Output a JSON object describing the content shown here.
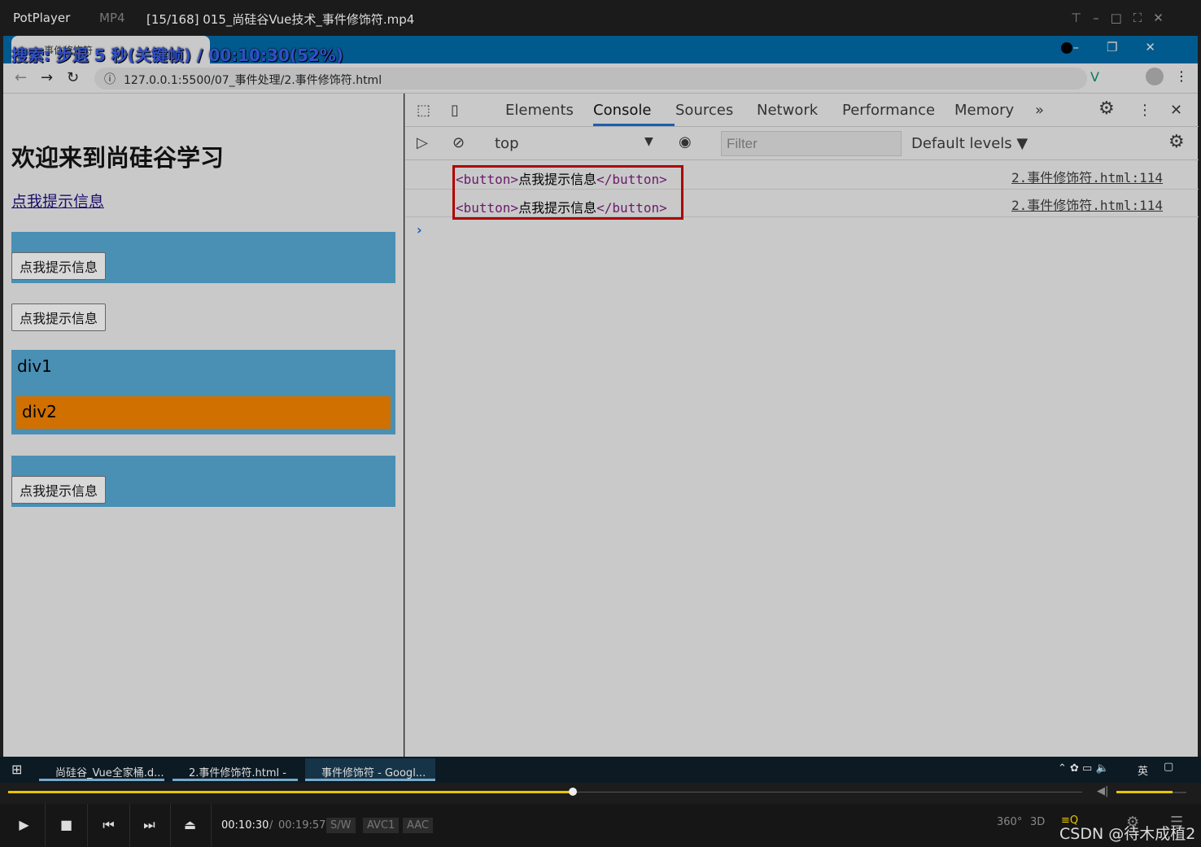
{
  "player": {
    "brand": "PotPlayer",
    "format": "MP4",
    "title": "[15/168] 015_尚硅谷Vue技术_事件修饰符.mp4",
    "osd": "搜索: 步退 5 秒(关键帧) / 00:10:30(52%)",
    "current_time": "00:10:30",
    "total_time": "00:19:57",
    "badges": [
      "S/W",
      "AVC1",
      "AAC"
    ],
    "progress": 0.526,
    "volume": 0.8,
    "watermark": "CSDN @待木成植2",
    "accent": "#e8c600"
  },
  "browser": {
    "url": "127.0.0.1:5500/07_事件处理/2.事件修饰符.html",
    "tab_title": "事件修饰符"
  },
  "page": {
    "heading": "欢迎来到尚硅谷学习",
    "link": "点我提示信息",
    "buttons": [
      "点我提示信息",
      "点我提示信息",
      "点我提示信息"
    ],
    "div1": "div1",
    "div2": "div2"
  },
  "devtools": {
    "tabs": [
      "Elements",
      "Console",
      "Sources",
      "Network",
      "Performance",
      "Memory"
    ],
    "active_tab": "Console",
    "context": "top",
    "filter_placeholder": "Filter",
    "levels": "Default levels ▼",
    "logs": [
      {
        "open": "<button>",
        "text": "点我提示信息",
        "close": "</button>",
        "source": "2.事件修饰符.html:114"
      },
      {
        "open": "<button>",
        "text": "点我提示信息",
        "close": "</button>",
        "source": "2.事件修饰符.html:114"
      }
    ]
  },
  "taskbar": {
    "items": [
      "尚硅谷_Vue全家桶.d...",
      "2.事件修饰符.html - ...",
      "事件修饰符 - Googl..."
    ],
    "ime": "英"
  }
}
